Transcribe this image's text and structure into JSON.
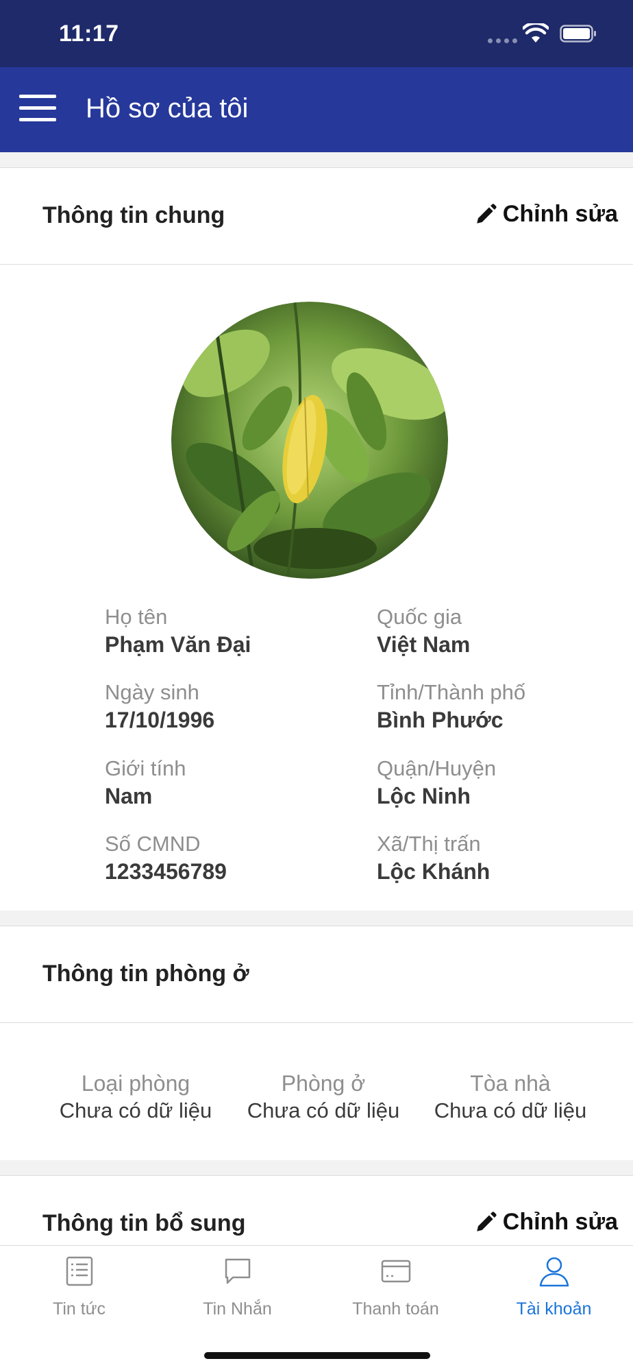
{
  "status_bar": {
    "time": "11:17"
  },
  "header": {
    "title": "Hồ sơ của tôi"
  },
  "general_section": {
    "title": "Thông tin chung",
    "edit_label": "Chỉnh sửa",
    "fields": [
      {
        "label": "Họ tên",
        "value": "Phạm Văn Đại"
      },
      {
        "label": "Quốc gia",
        "value": "Việt Nam"
      },
      {
        "label": "Ngày sinh",
        "value": "17/10/1996"
      },
      {
        "label": "Tỉnh/Thành phố",
        "value": "Bình Phước"
      },
      {
        "label": "Giới tính",
        "value": "Nam"
      },
      {
        "label": "Quận/Huyện",
        "value": "Lộc Ninh"
      },
      {
        "label": "Số CMND",
        "value": "1233456789"
      },
      {
        "label": "Xã/Thị trấn",
        "value": "Lộc Khánh"
      }
    ]
  },
  "room_section": {
    "title": "Thông tin phòng ở",
    "fields": [
      {
        "label": "Loại phòng",
        "value": "Chưa có dữ liệu"
      },
      {
        "label": "Phòng ở",
        "value": "Chưa có dữ liệu"
      },
      {
        "label": "Tòa nhà",
        "value": "Chưa có dữ liệu"
      }
    ]
  },
  "extra_section": {
    "title": "Thông tin bổ sung",
    "edit_label": "Chỉnh sửa"
  },
  "tabs": [
    {
      "label": "Tin tức",
      "icon": "news-icon"
    },
    {
      "label": "Tin Nhắn",
      "icon": "chat-icon"
    },
    {
      "label": "Thanh toán",
      "icon": "card-icon"
    },
    {
      "label": "Tài khoản",
      "icon": "user-icon",
      "active": true
    }
  ],
  "colors": {
    "status_bar": "#1e2a69",
    "header": "#26389a",
    "active_tab": "#1a73d9"
  }
}
